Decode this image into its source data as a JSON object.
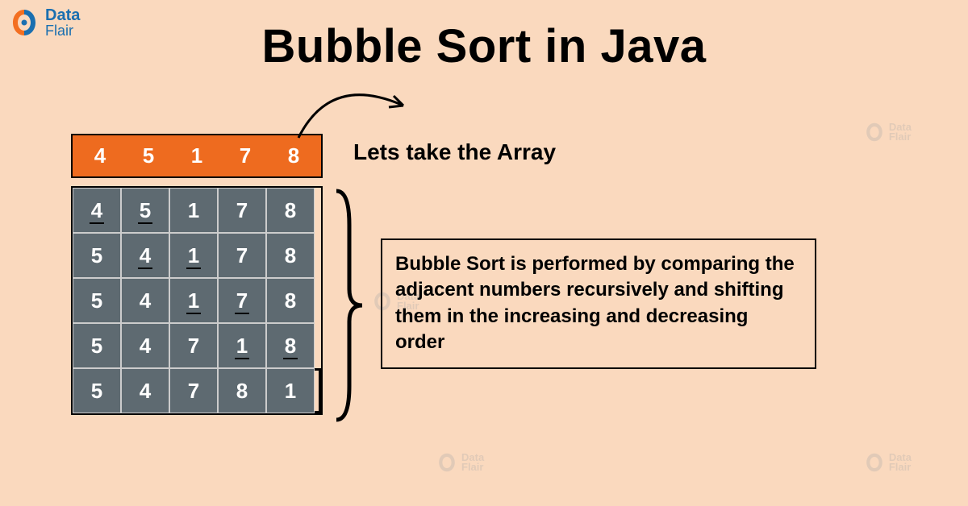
{
  "logo": {
    "brand1": "Data",
    "brand2": "Flair"
  },
  "title": "Bubble Sort in Java",
  "subtitle": "Lets take the Array",
  "description": "Bubble Sort is performed by comparing the adjacent numbers recursively and shifting them in the increasing and decreasing order",
  "initialArray": [
    "4",
    "5",
    "1",
    "7",
    "8"
  ],
  "steps": [
    {
      "values": [
        "4",
        "5",
        "1",
        "7",
        "8"
      ],
      "underline": [
        0,
        1
      ],
      "boxed": false
    },
    {
      "values": [
        "5",
        "4",
        "1",
        "7",
        "8"
      ],
      "underline": [
        1,
        2
      ],
      "boxed": false
    },
    {
      "values": [
        "5",
        "4",
        "1",
        "7",
        "8"
      ],
      "underline": [
        2,
        3
      ],
      "boxed": false
    },
    {
      "values": [
        "5",
        "4",
        "7",
        "1",
        "8"
      ],
      "underline": [
        3,
        4
      ],
      "boxed": false
    },
    {
      "values": [
        "5",
        "4",
        "7",
        "8",
        "1"
      ],
      "underline": [],
      "boxed": true
    }
  ],
  "watermark": {
    "brand1": "Data",
    "brand2": "Flair"
  }
}
